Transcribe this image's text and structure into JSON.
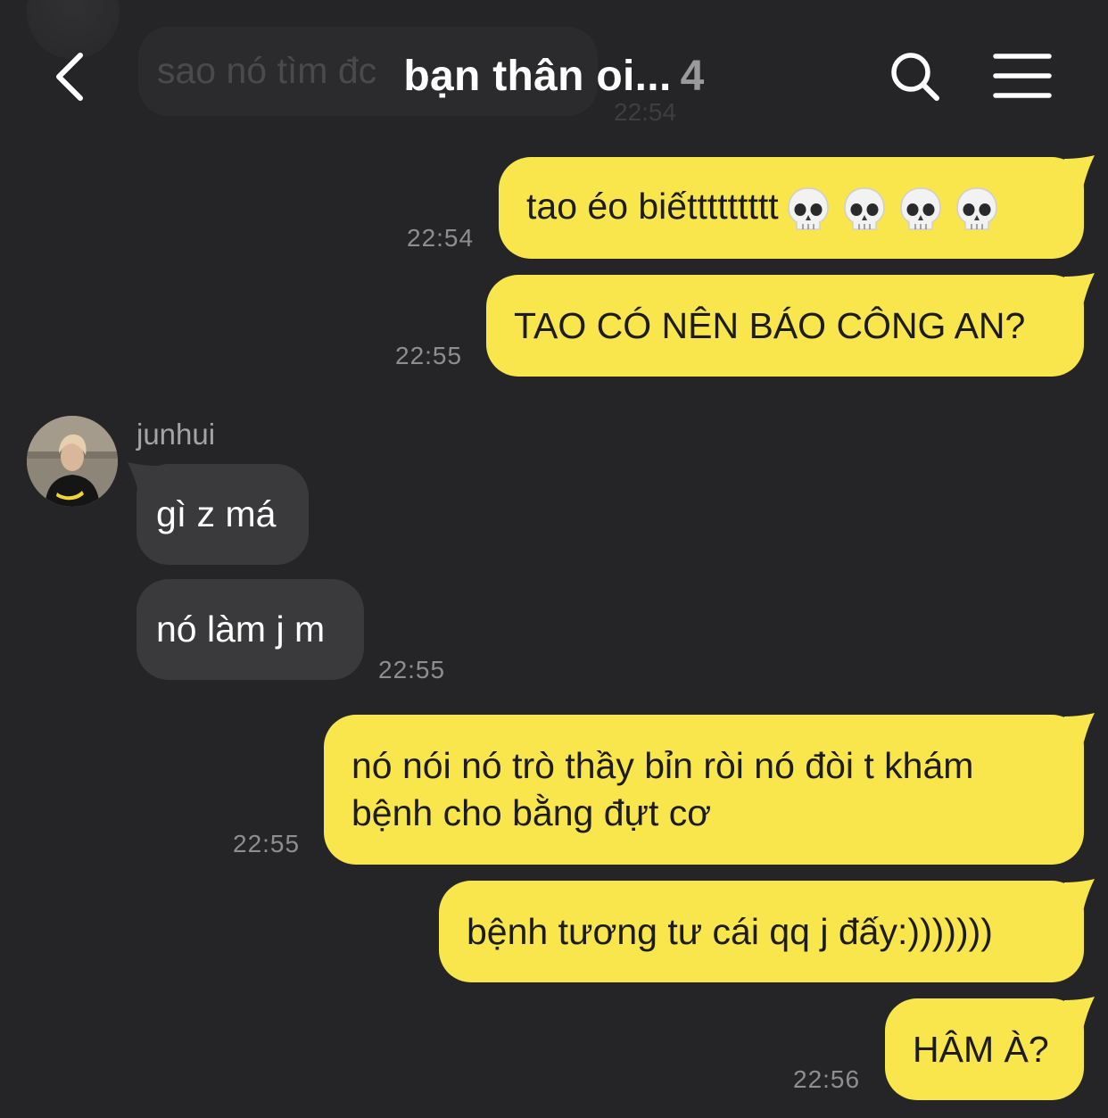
{
  "header": {
    "title": "bạn thân oi...",
    "member_count": "4",
    "back_icon": "chevron-left-icon",
    "search_icon": "search-icon",
    "menu_icon": "hamburger-menu-icon"
  },
  "faded_message": {
    "text": "sao nó tìm đc",
    "time": "22:54"
  },
  "colors": {
    "background": "#252527",
    "outgoing_bubble": "#f9e54c",
    "incoming_bubble": "#3a3a3c",
    "timestamp": "#8e8e90"
  },
  "messages": [
    {
      "direction": "out",
      "text": "tao éo biếttttttttt",
      "emoji": [
        "skull",
        "skull",
        "skull",
        "skull"
      ],
      "time": "22:54"
    },
    {
      "direction": "out",
      "text": "TAO CÓ NÊN BÁO CÔNG AN?",
      "time": "22:55"
    },
    {
      "direction": "in",
      "sender": "junhui",
      "text": "gì z má"
    },
    {
      "direction": "in",
      "text": "nó làm j m",
      "time": "22:55"
    },
    {
      "direction": "out",
      "lines": [
        "nó nói nó trò thầy bỉn ròi nó đòi t khám",
        "bệnh cho bằng đựt cơ"
      ],
      "time": "22:55"
    },
    {
      "direction": "out",
      "text": "bệnh tương tư cái qq j đấy:)))))))"
    },
    {
      "direction": "out",
      "text": "HÂM À?",
      "time": "22:56"
    }
  ]
}
